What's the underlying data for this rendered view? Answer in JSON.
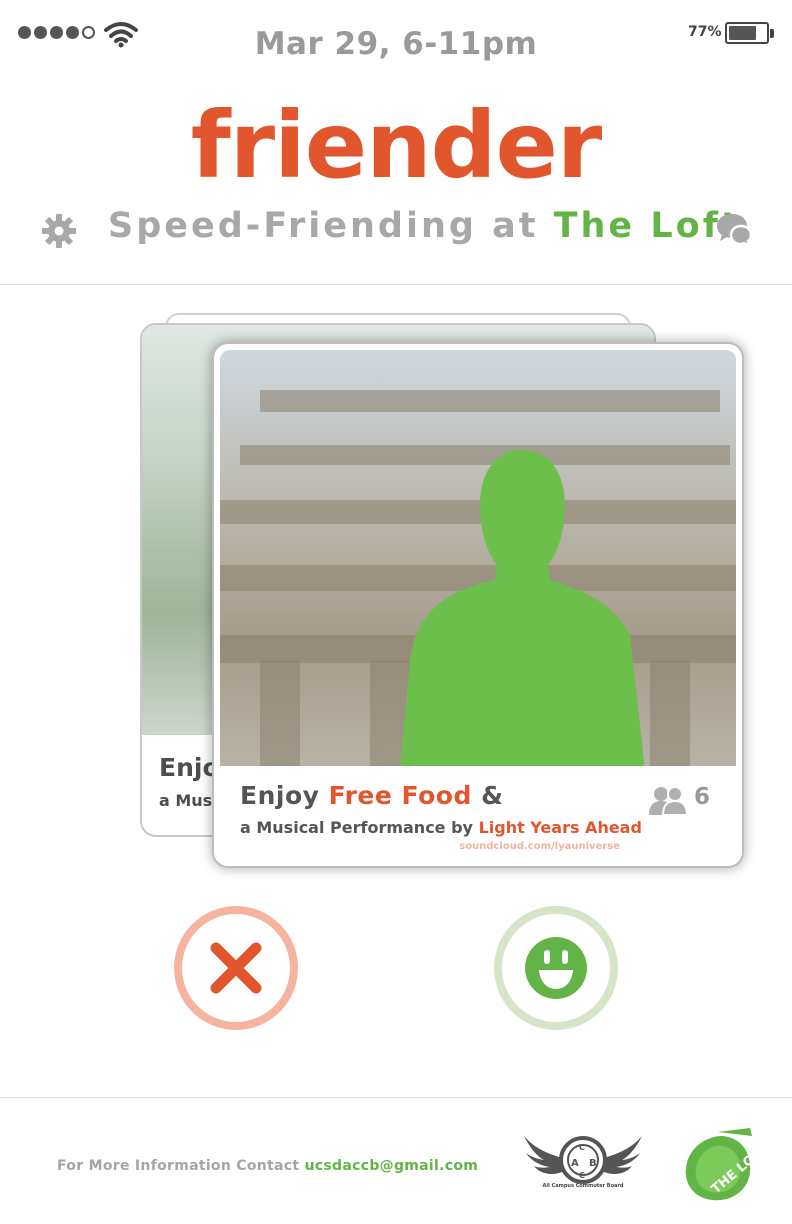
{
  "status_bar": {
    "battery_percent": "77%",
    "battery_level": 0.77,
    "signal_bars": 4,
    "signal_total": 5
  },
  "header": {
    "datetime": "Mar 29, 6-11pm",
    "logo": "friender",
    "subtitle_prefix": "Speed-Friending at ",
    "subtitle_venue": "The Loft",
    "settings_icon": "gear-icon",
    "chat_icon": "chat-bubbles-icon"
  },
  "card_back": {
    "title": "Enjo",
    "subtitle": "a Musi"
  },
  "card_front": {
    "title_prefix": "Enjoy ",
    "title_highlight": "Free Food",
    "title_suffix": " &",
    "subtitle_prefix": "a Musical Performance by ",
    "subtitle_highlight": "Light Years Ahead",
    "link": "soundcloud.com/lyauniverse",
    "attendee_count": "6",
    "people_icon": "people-icon"
  },
  "actions": {
    "reject_icon": "x-icon",
    "like_icon": "smiley-icon"
  },
  "footer": {
    "contact_prefix": "For More Information Contact ",
    "contact_email": "ucsdaccb@gmail.com",
    "accb_caption": "All Campus Commuter Board",
    "loft_logo_text": "THE LOFT"
  },
  "colors": {
    "brand_orange": "#e2562d",
    "brand_green": "#63b446",
    "gray_text": "#a8a8a8"
  }
}
